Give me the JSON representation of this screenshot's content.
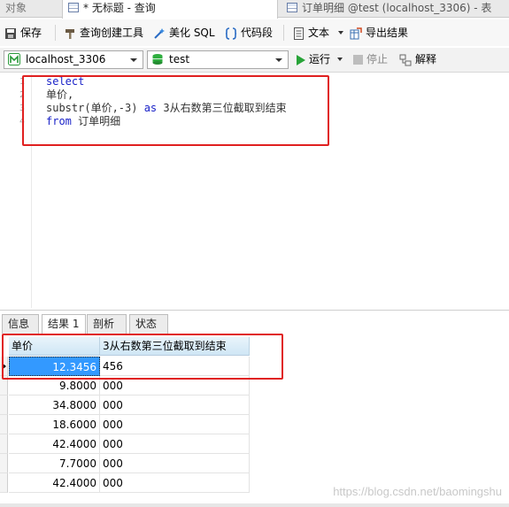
{
  "tabs": [
    {
      "label": "对象"
    },
    {
      "label": "* 无标题 - 查询"
    },
    {
      "label": "订单明细 @test (localhost_3306) - 表"
    }
  ],
  "toolbar": {
    "save": "保存",
    "query_builder": "查询创建工具",
    "beautify": "美化 SQL",
    "snippet": "代码段",
    "text": "文本",
    "export": "导出结果"
  },
  "connection": {
    "server": "localhost_3306",
    "database": "test",
    "run": "运行",
    "stop": "停止",
    "explain": "解释"
  },
  "editor": {
    "line_numbers": [
      "1",
      "2",
      "3",
      "4"
    ],
    "line1_kw": "select",
    "line2": "单价,",
    "line3_pre": "substr(单价,-3) ",
    "line3_kw": "as",
    "line3_post": " 3从右数第三位截取到结束",
    "line4_kw": "from",
    "line4_post": " 订单明细"
  },
  "result_tabs": [
    "信息",
    "结果 1",
    "剖析",
    "状态"
  ],
  "grid": {
    "columns": [
      "单价",
      "3从右数第三位截取到结束"
    ],
    "rows": [
      [
        "12.3456",
        "456"
      ],
      [
        "9.8000",
        "000"
      ],
      [
        "34.8000",
        "000"
      ],
      [
        "18.6000",
        "000"
      ],
      [
        "42.4000",
        "000"
      ],
      [
        "7.7000",
        "000"
      ],
      [
        "42.4000",
        "000"
      ]
    ]
  },
  "watermark": "https://blog.csdn.net/baomingshu",
  "colors": {
    "highlight_box": "#e02020",
    "keyword": "#1a22c8",
    "selection": "#3399ff"
  }
}
